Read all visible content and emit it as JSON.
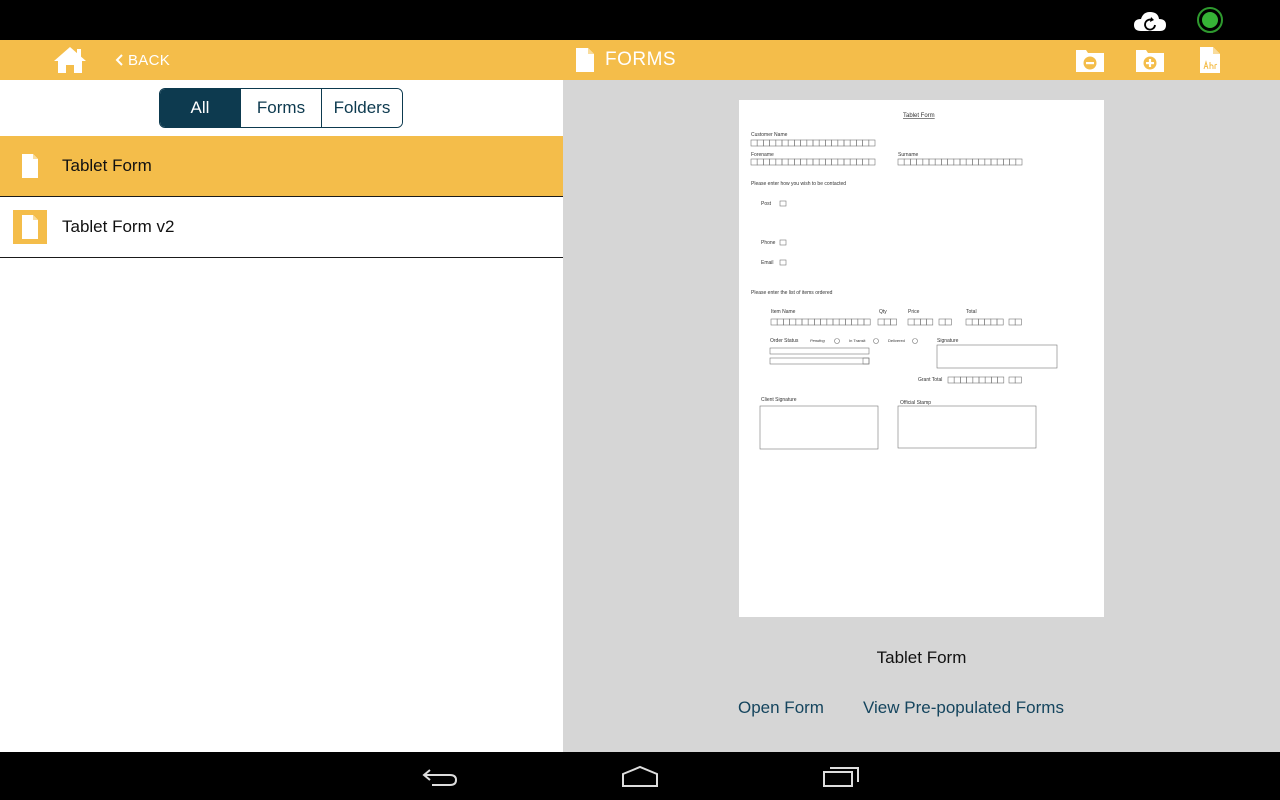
{
  "status_bar": {
    "icons": [
      "cloud-sync-icon",
      "connection-status-icon"
    ],
    "status_color": "#36b336"
  },
  "toolbar": {
    "back_label": "BACK",
    "title": "FORMS",
    "actions": [
      "remove-folder-icon",
      "add-folder-icon",
      "rename-form-icon"
    ],
    "accent_color": "#f4bd4a"
  },
  "filter": {
    "options": [
      "All",
      "Forms",
      "Folders"
    ],
    "selected": "All"
  },
  "forms_list": [
    {
      "name": "Tablet Form",
      "selected": true
    },
    {
      "name": "Tablet Form v2",
      "selected": false
    }
  ],
  "preview": {
    "form_name": "Tablet Form",
    "sheet": {
      "heading": "Tablet Form",
      "customer_name": "Customer Name",
      "forename": "Forename",
      "surname": "Surname",
      "contact_prompt": "Please enter how you wish to be contacted",
      "contact_options": [
        "Post",
        "Phone",
        "Email"
      ],
      "items_prompt": "Please enter the list of items ordered",
      "item_name": "Item Name",
      "qty": "Qty",
      "price": "Price",
      "total": "Total",
      "order_status": "Order Status",
      "status_options": [
        "Pending",
        "In Transit",
        "Delivered"
      ],
      "signature": "Signature",
      "grant_total": "Grant Total",
      "client_signature": "Client Signature",
      "official_stamp": "Official Stamp"
    },
    "open_label": "Open Form",
    "prepopulated_label": "View Pre-populated Forms"
  },
  "navigation": {
    "icons": [
      "back-nav-icon",
      "home-nav-icon",
      "recents-nav-icon"
    ]
  }
}
